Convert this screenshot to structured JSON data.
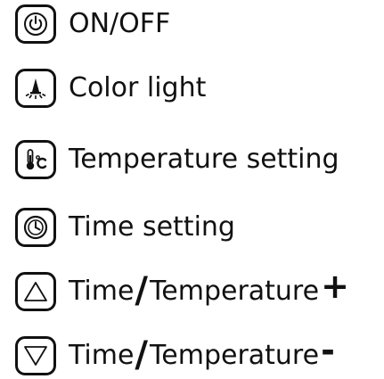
{
  "legend": {
    "items": [
      {
        "icon": "power-icon",
        "label": "ON/OFF"
      },
      {
        "icon": "light-bulb-icon",
        "label": "Color light"
      },
      {
        "icon": "thermometer-icon",
        "label": "Temperature setting"
      },
      {
        "icon": "clock-icon",
        "label": "Time setting"
      },
      {
        "icon": "triangle-up-icon",
        "label_a": "Time",
        "slash": "/",
        "label_b": "Temperature",
        "sign": "+"
      },
      {
        "icon": "triangle-down-icon",
        "label_a": "Time",
        "slash": "/",
        "label_b": "Temperature",
        "sign": "-"
      }
    ]
  }
}
